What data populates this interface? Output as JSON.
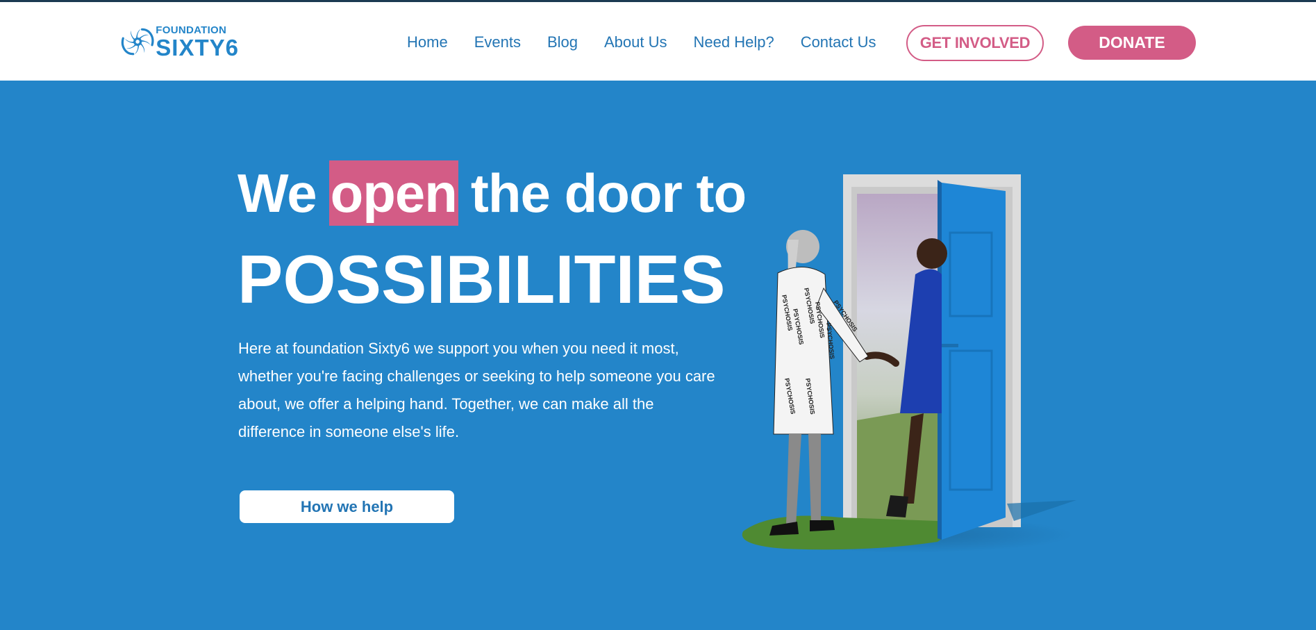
{
  "logo": {
    "top": "FOUNDATION",
    "bottom": "SIXTY6",
    "icon": "spiral-logo-icon",
    "color": "#2385c9"
  },
  "nav": {
    "items": [
      {
        "label": "Home"
      },
      {
        "label": "Events"
      },
      {
        "label": "Blog"
      },
      {
        "label": "About Us"
      },
      {
        "label": "Need Help?"
      },
      {
        "label": "Contact Us"
      }
    ],
    "get_involved": "GET INVOLVED",
    "donate": "DONATE"
  },
  "hero": {
    "line1_before": "We",
    "line1_highlight": "open",
    "line1_after": "the door to",
    "line2": "POSSIBILITIES",
    "paragraph": "Here at foundation Sixty6 we support you when you need it most, whether you're facing challenges or seeking to help someone you care about, we offer a helping hand. Together, we can make all the difference in someone else's life.",
    "cta": "How we help",
    "illustration_text": "PSYCHOSIS"
  },
  "colors": {
    "brand_blue": "#2385c9",
    "accent_pink": "#d35c86",
    "nav_text": "#2375b4",
    "header_bg": "#ffffff"
  }
}
